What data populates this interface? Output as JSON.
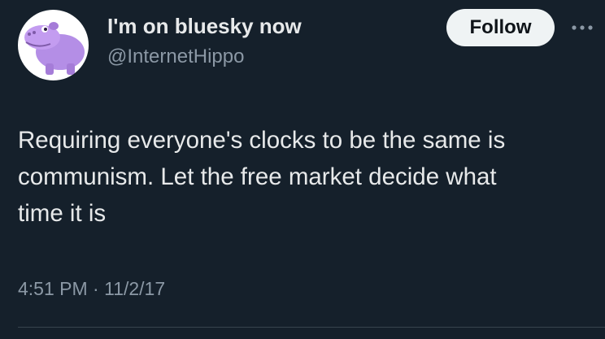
{
  "author": {
    "display_name": "I'm on bluesky now",
    "handle": "@InternetHippo",
    "avatar_icon": "purple-hippo-icon"
  },
  "actions": {
    "follow_label": "Follow",
    "more_icon": "more-horizontal-icon"
  },
  "tweet": {
    "text": "Requiring everyone's clocks to be the same is\ncommunism. Let the free market decide what\ntime it is",
    "time": "4:51 PM",
    "separator": "·",
    "date": "11/2/17"
  },
  "colors": {
    "background": "#15202b",
    "text_primary": "#e7e9ea",
    "text_secondary": "#8b98a5",
    "follow_bg": "#eff3f4",
    "follow_text": "#0f1419",
    "avatar_hippo": "#b48ee6"
  }
}
